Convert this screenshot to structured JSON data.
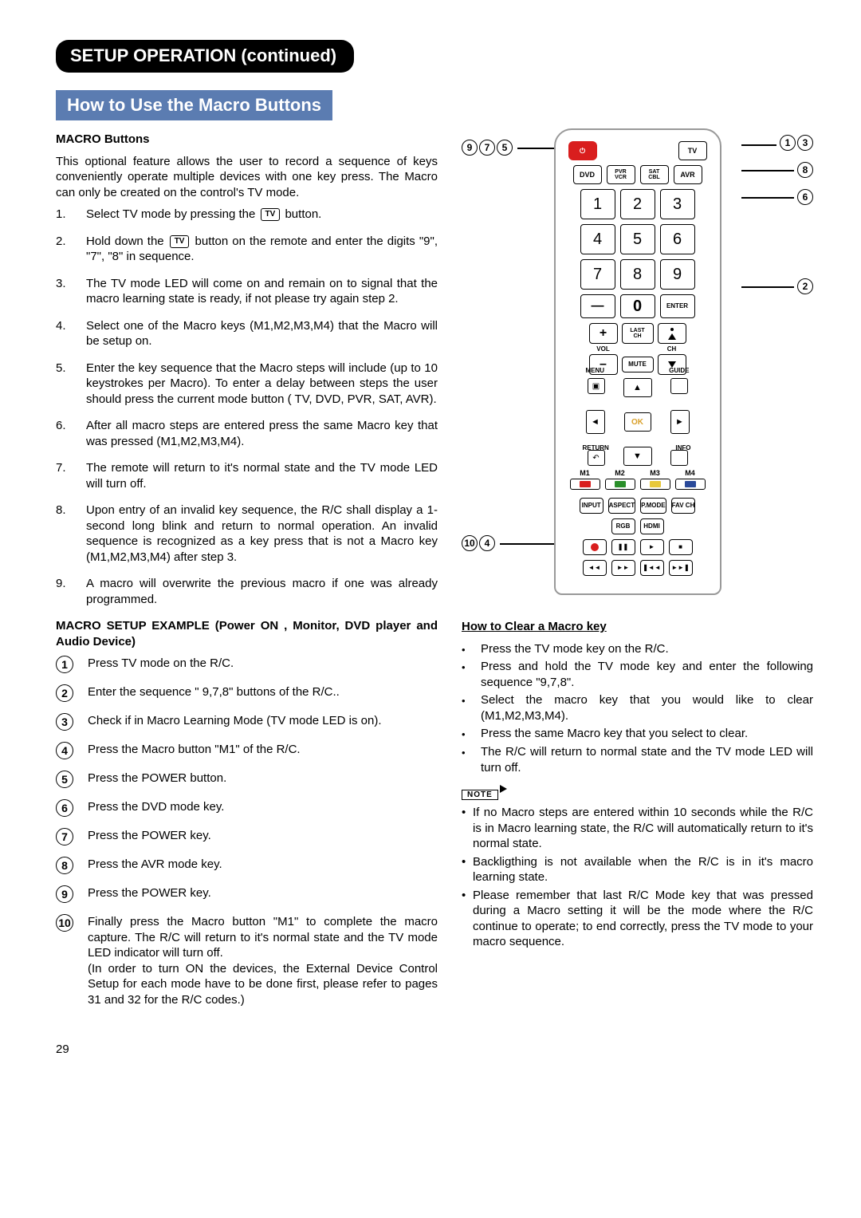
{
  "header": {
    "section_title": "SETUP OPERATION (continued)",
    "sub_title": "How to Use the Macro Buttons"
  },
  "macro": {
    "heading": "MACRO Buttons",
    "intro": "This optional feature allows the user to record a sequence of keys conveniently operate multiple devices with one key press. The Macro can only be created on the control's TV mode.",
    "tv_label": "TV",
    "steps": [
      "Select TV mode by pressing the [TV] button.",
      "Hold down the [TV] button on the remote and enter the digits \"9\", \"7\", \"8\" in sequence.",
      "The TV mode LED will come on and remain on to signal that the macro learning state is ready, if not please try again step 2.",
      "Select one of the Macro keys (M1,M2,M3,M4) that the Macro will be setup on.",
      "Enter the key sequence that the Macro steps will include (up to 10 keystrokes per Macro). To enter a delay between steps the user should press the  current mode button ( TV, DVD, PVR, SAT, AVR).",
      "After all macro steps are entered press the same Macro key that was pressed (M1,M2,M3,M4).",
      "The remote will return to it's normal state and the TV mode LED will turn off.",
      "Upon entry of an invalid key sequence, the R/C shall display a 1-second long blink and return to normal operation. An invalid sequence is recognized as a key press that is not a Macro key (M1,M2,M3,M4) after step 3.",
      "A macro will overwrite the previous macro if one was already programmed."
    ]
  },
  "example": {
    "heading": "MACRO SETUP EXAMPLE (Power ON , Monitor, DVD player and Audio Device)",
    "steps": [
      "Press TV mode on the R/C.",
      "Enter the sequence \" 9,7,8\" buttons of the R/C..",
      "Check if in Macro Learning Mode (TV mode LED is on).",
      "Press the Macro button \"M1\" of the R/C.",
      "Press the POWER button.",
      "Press the DVD mode key.",
      "Press the POWER key.",
      "Press the AVR mode key.",
      "Press the POWER key.",
      "Finally press the Macro button \"M1\" to complete the macro capture. The R/C will return to it's normal state and the TV mode LED indicator will turn off.\n(In order to turn ON the devices, the External Device Control Setup for each mode have to be done first, please refer to pages 31 and 32 for the R/C codes.)"
    ]
  },
  "clear": {
    "heading": "How to Clear a Macro key",
    "items": [
      "Press the TV mode key on the R/C.",
      "Press and hold the TV mode key and enter the following sequence \"9,7,8\".",
      "Select the macro key that you would like to clear (M1,M2,M3,M4).",
      "Press the same Macro key that you select to clear.",
      "The R/C will return to normal state and the TV mode LED will turn off."
    ]
  },
  "note": {
    "label": "NOTE",
    "items": [
      "If no Macro steps are entered within 10 seconds while the R/C is in Macro learning state, the R/C will automatically return to it's normal state.",
      "Backligthing is not available when the R/C is in it's macro learning state.",
      "Please remember that last R/C Mode key that was pressed during a Macro setting it will be the mode where the R/C continue to operate; to end correctly, press the TV mode to your macro sequence."
    ]
  },
  "remote": {
    "power": "⏻",
    "modes": [
      "TV",
      "DVD",
      "PVR\nVCR",
      "SAT\nCBL",
      "AVR"
    ],
    "numbers": [
      [
        "1",
        "2",
        "3"
      ],
      [
        "4",
        "5",
        "6"
      ],
      [
        "7",
        "8",
        "9"
      ],
      [
        "—",
        "0",
        "ENTER"
      ]
    ],
    "vol": "VOL",
    "ch": "CH",
    "last_ch": "LAST\nCH",
    "mute": "MUTE",
    "menu": "MENU",
    "guide": "GUIDE",
    "return": "RETURN",
    "info": "INFO",
    "ok": "OK",
    "macro": [
      "M1",
      "M2",
      "M3",
      "M4"
    ],
    "row_a": [
      "INPUT",
      "ASPECT",
      "P.MODE",
      "FAV CH"
    ],
    "row_b": [
      "RGB",
      "HDMI"
    ],
    "transport_a": [
      "●",
      "❚❚",
      "►",
      "■"
    ],
    "transport_b": [
      "◄◄",
      "►►",
      "❚◄◄",
      "►►❚"
    ]
  },
  "callouts": {
    "left_top": [
      "9",
      "7",
      "5"
    ],
    "right_top": [
      "1",
      "3"
    ],
    "right_mid": "8",
    "right_mid2": "6",
    "right_mid3": "2",
    "left_bottom": [
      "10",
      "4"
    ]
  },
  "page": "29"
}
